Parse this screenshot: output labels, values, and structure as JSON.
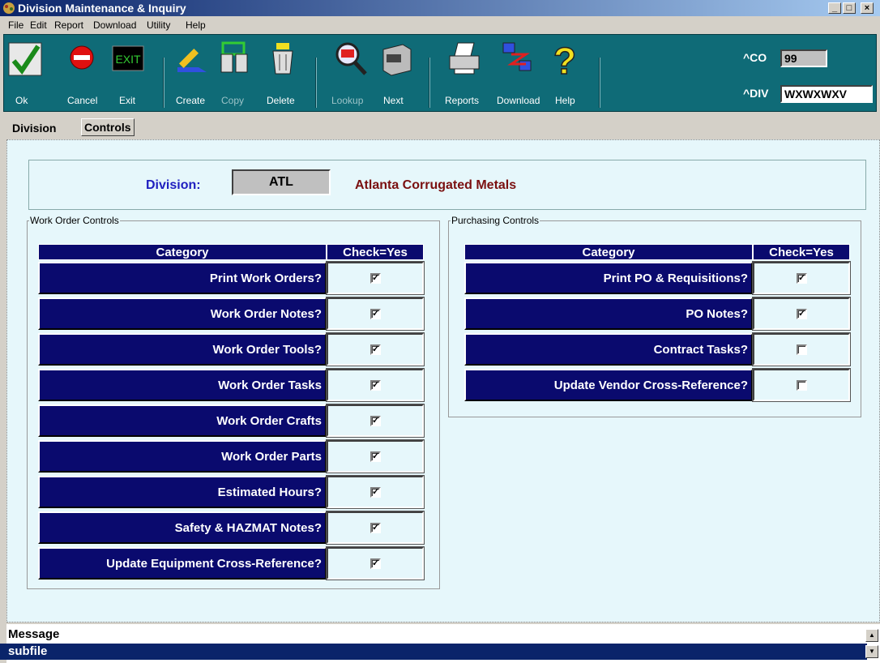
{
  "window": {
    "title": "Division Maintenance & Inquiry"
  },
  "menu": [
    "File",
    "Edit",
    "Report",
    "Download",
    "Utility",
    "Help"
  ],
  "toolbar": {
    "ok": "Ok",
    "cancel": "Cancel",
    "exit": "Exit",
    "create": "Create",
    "copy": "Copy",
    "delete": "Delete",
    "lookup": "Lookup",
    "next": "Next",
    "reports": "Reports",
    "download": "Download",
    "help": "Help",
    "exit_icon_text": "EXIT"
  },
  "header": {
    "co_label": "^CO",
    "co_value": "99",
    "div_label": "^DIV",
    "div_value": "WXWXWXV"
  },
  "tabs": [
    "Division",
    "Controls"
  ],
  "division": {
    "label": "Division:",
    "code": "ATL",
    "name": "Atlanta Corrugated Metals"
  },
  "work_order": {
    "legend": "Work Order Controls",
    "col_category": "Category",
    "col_check": "Check=Yes",
    "rows": [
      {
        "label": "Print Work Orders?",
        "checked": true
      },
      {
        "label": "Work Order Notes?",
        "checked": true
      },
      {
        "label": "Work Order Tools?",
        "checked": true
      },
      {
        "label": "Work Order Tasks",
        "checked": true
      },
      {
        "label": "Work Order Crafts",
        "checked": true
      },
      {
        "label": "Work Order Parts",
        "checked": true
      },
      {
        "label": "Estimated Hours?",
        "checked": true
      },
      {
        "label": "Safety & HAZMAT Notes?",
        "checked": true
      },
      {
        "label": "Update Equipment Cross-Reference?",
        "checked": true
      }
    ]
  },
  "purchasing": {
    "legend": "Purchasing Controls",
    "col_category": "Category",
    "col_check": "Check=Yes",
    "rows": [
      {
        "label": "Print PO & Requisitions?",
        "checked": true
      },
      {
        "label": "PO Notes?",
        "checked": true
      },
      {
        "label": "Contract Tasks?",
        "checked": false
      },
      {
        "label": "Update Vendor Cross-Reference?",
        "checked": false
      }
    ]
  },
  "message": {
    "title": "Message",
    "line": "subfile"
  }
}
